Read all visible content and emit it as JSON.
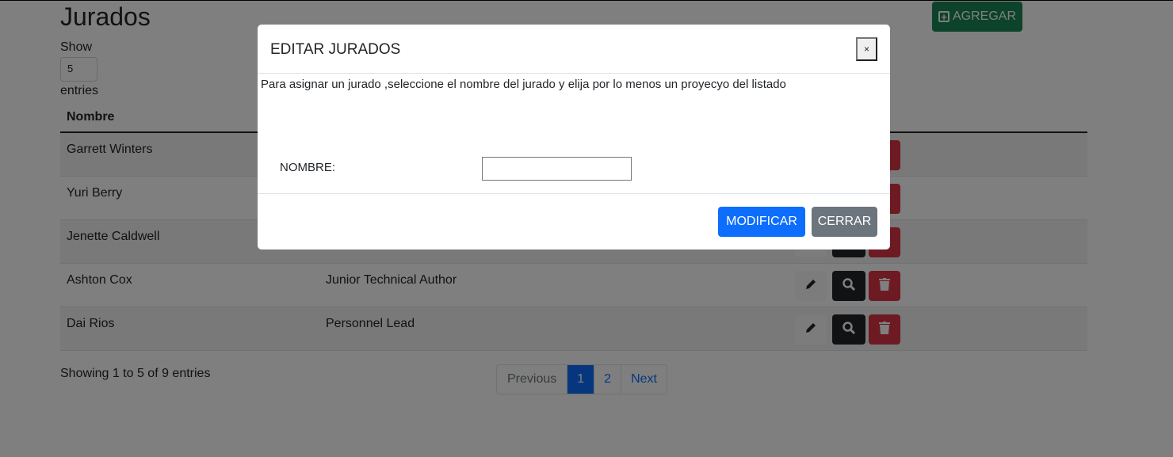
{
  "page": {
    "title": "Jurados",
    "add_label": "AGREGAR",
    "show_label": "Show",
    "entries_value": "5",
    "entries_label": "entries",
    "columns": [
      "Nombre"
    ],
    "rows": [
      {
        "name": "Garrett Winters",
        "role": ""
      },
      {
        "name": "Yuri Berry",
        "role": ""
      },
      {
        "name": "Jenette Caldwell",
        "role": ""
      },
      {
        "name": "Ashton Cox",
        "role": "Junior Technical Author"
      },
      {
        "name": "Dai Rios",
        "role": "Personnel Lead"
      }
    ],
    "info": "Showing 1 to 5 of 9 entries",
    "pagination": {
      "previous": "Previous",
      "pages": [
        "1",
        "2"
      ],
      "active": "1",
      "next": "Next"
    },
    "colors": {
      "add": "#198754",
      "search": "#212529",
      "delete": "#dc3545",
      "primary": "#0d6efd",
      "secondary": "#6c757d"
    }
  },
  "modal": {
    "title": "EDITAR JURADOS",
    "close": "×",
    "intro": "Para asignar un jurado ,seleccione el nombre del jurado y elija por lo menos un proyecyo del listado",
    "name_label": "NOMBRE:",
    "name_value": "",
    "modify": "MODIFICAR",
    "cancel": "CERRAR"
  }
}
